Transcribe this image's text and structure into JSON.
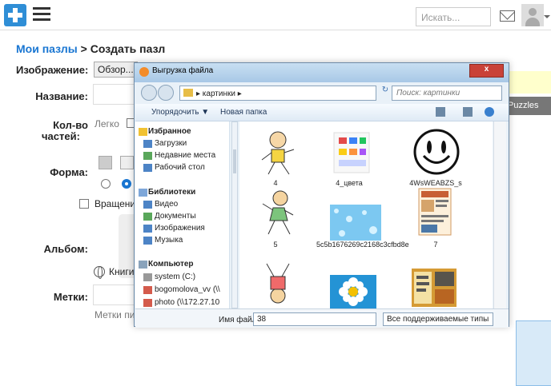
{
  "header": {
    "search_placeholder": "Искать..."
  },
  "page": {
    "breadcrumb_link": "Мои пазлы",
    "breadcrumb_separator": " > ",
    "page_title": "Создать пазл"
  },
  "form": {
    "image_label": "Изображение:",
    "browse_button": "Обзор...",
    "name_label": "Название:",
    "pieces_label_line1": "Кол-во",
    "pieces_label_line2": "частей:",
    "difficulty_easy": "Легко",
    "shape_label": "Форма:",
    "rotation_label": "Вращение",
    "album_label": "Альбом:",
    "books_label": "Книги",
    "tags_label": "Метки:",
    "tags_hint": "Метки пи",
    "puzzles_label": "Puzzles"
  },
  "dialog": {
    "title": "Выгрузка файла",
    "close_label": "x",
    "address_path": "▸ картинки ▸",
    "search_placeholder": "Поиск: картинки",
    "organize_button": "Упорядочить ▼",
    "new_folder_button": "Новая папка",
    "nav": {
      "favorites": "Избранное",
      "downloads": "Загрузки",
      "recent": "Недавние места",
      "desktop": "Рабочий стол",
      "libraries": "Библиотеки",
      "video": "Видео",
      "documents": "Документы",
      "images": "Изображения",
      "music": "Музыка",
      "computer": "Компьютер",
      "system": "system (C:)",
      "bogomolova": "bogomolova_vv (\\\\",
      "photo": "photo (\\\\172.27.10"
    },
    "files": [
      {
        "name": "4"
      },
      {
        "name": "4_цвета"
      },
      {
        "name": "4WsWEABZS_s"
      },
      {
        "name": "5"
      },
      {
        "name": "5c5b1676269c2168c3cfbd8e"
      },
      {
        "name": "7"
      },
      {
        "name": ""
      },
      {
        "name": ""
      },
      {
        "name": ""
      }
    ],
    "filename_label": "Имя файла:",
    "filename_value": "38",
    "file_type_select": "Все поддерживаемые типы"
  }
}
